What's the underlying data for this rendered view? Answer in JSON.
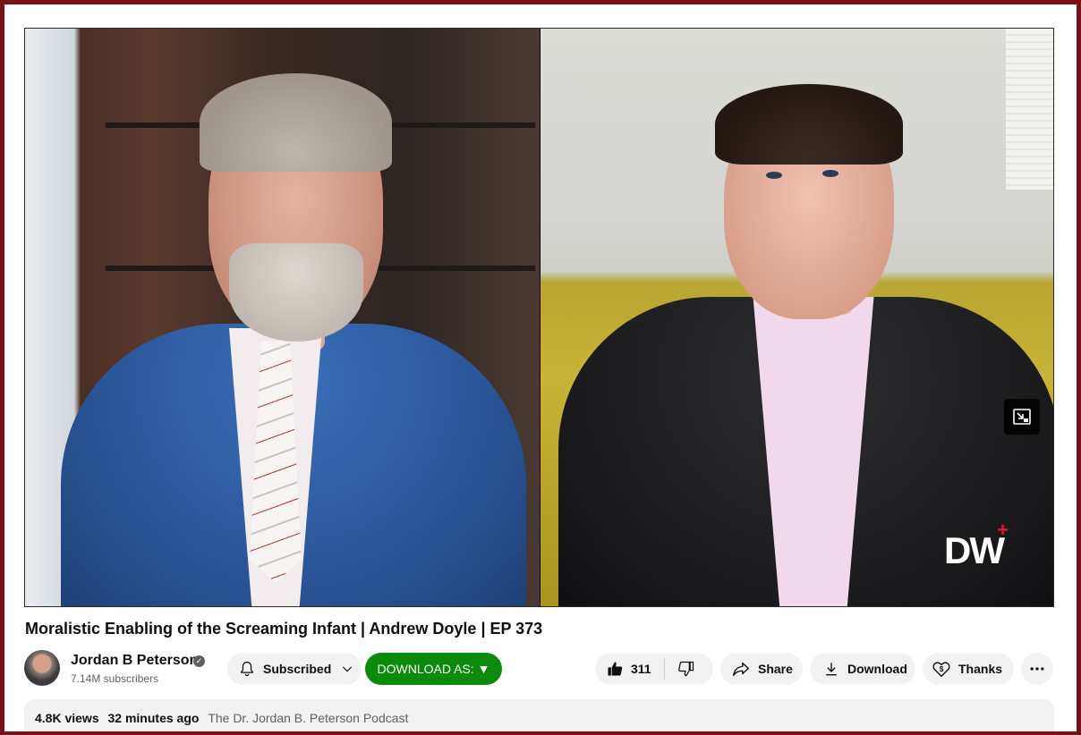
{
  "video": {
    "title": "Moralistic Enabling of the Screaming Infant | Andrew Doyle | EP 373",
    "watermark_text": "DW",
    "watermark_mark": "+",
    "watermark_mark_color": "#e0192b"
  },
  "channel": {
    "name": "Jordan B Peterson",
    "subscribers": "7.14M subscribers",
    "verified": true
  },
  "actions": {
    "subscribed_label": "Subscribed",
    "download_as_label": "DOWNLOAD AS: ▼",
    "download_as_color": "#0c8a0c",
    "like_count": "311",
    "share_label": "Share",
    "download_label": "Download",
    "thanks_label": "Thanks"
  },
  "description": {
    "views": "4.8K views",
    "published": "32 minutes ago",
    "podcast": "The Dr. Jordan B. Peterson Podcast"
  },
  "icons": [
    "bell-icon",
    "chevron-down-icon",
    "thumb-up-icon",
    "thumb-down-icon",
    "share-icon",
    "download-icon",
    "thanks-icon",
    "more-icon",
    "miniplayer-icon",
    "verified-icon"
  ],
  "colors": {
    "frame_border": "#7a1117",
    "pill_bg": "#f2f2f2"
  }
}
